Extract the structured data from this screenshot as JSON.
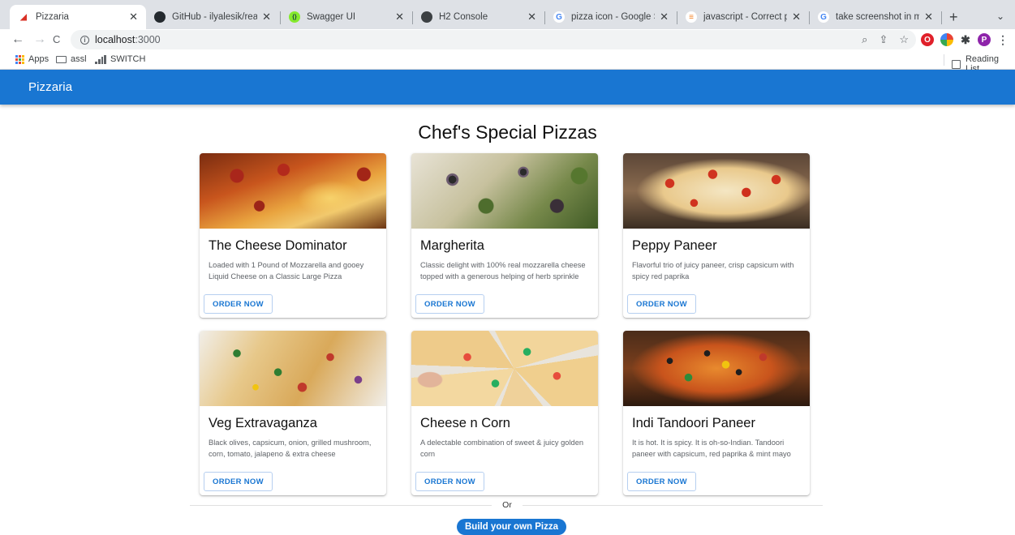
{
  "browser": {
    "tabs": [
      {
        "label": "Pizzaria",
        "close": "✕",
        "color": "#d93025",
        "glyph": "◢"
      },
      {
        "label": "GitHub - ilyalesik/react-fetc",
        "close": "✕",
        "color": "#24292e",
        "glyph": "●"
      },
      {
        "label": "Swagger UI",
        "close": "✕",
        "color": "#85ea2d",
        "glyph": "{}"
      },
      {
        "label": "H2 Console",
        "close": "✕",
        "color": "#3c4043",
        "glyph": "◉"
      },
      {
        "label": "pizza icon - Google Search",
        "close": "✕",
        "color": "#4285f4",
        "glyph": "G"
      },
      {
        "label": "javascript - Correct path for",
        "close": "✕",
        "color": "#f48024",
        "glyph": "≡"
      },
      {
        "label": "take screenshot in mac - Go",
        "close": "✕",
        "color": "#4285f4",
        "glyph": "G"
      }
    ],
    "new_tab": "+",
    "tab_menu": "⌄",
    "nav": {
      "back": "←",
      "forward": "→",
      "reload": "C"
    },
    "url": {
      "info": "i",
      "host": "localhost",
      "port": ":3000"
    },
    "omni_icons": {
      "zoom": "⌕",
      "share": "⇪",
      "star": "☆"
    },
    "extensions": {
      "opera": "O",
      "profile": "P"
    },
    "bookmarks": [
      {
        "label": "Apps"
      },
      {
        "label": "assl"
      },
      {
        "label": "SWITCH"
      }
    ],
    "reading_list": "Reading List"
  },
  "app": {
    "brand": "Pizzaria",
    "primary_color": "#1976d2",
    "heading": "Chef's Special Pizzas",
    "pizzas": [
      {
        "name": "The Cheese Dominator",
        "description": "Loaded with 1 Pound of Mozzarella and gooey Liquid Cheese on a Classic Large Pizza",
        "button": "ORDER NOW"
      },
      {
        "name": "Margherita",
        "description": "Classic delight with 100% real mozzarella cheese topped with a generous helping of herb sprinkle",
        "button": "ORDER NOW"
      },
      {
        "name": "Peppy Paneer",
        "description": "Flavorful trio of juicy paneer, crisp capsicum with spicy red paprika",
        "button": "ORDER NOW"
      },
      {
        "name": "Veg Extravaganza",
        "description": "Black olives, capsicum, onion, grilled mushroom, corn, tomato, jalapeno & extra cheese",
        "button": "ORDER NOW"
      },
      {
        "name": "Cheese n Corn",
        "description": "A delectable combination of sweet & juicy golden corn",
        "button": "ORDER NOW"
      },
      {
        "name": "Indi Tandoori Paneer",
        "description": "It is hot. It is spicy. It is oh-so-Indian. Tandoori paneer with capsicum, red paprika & mint mayo",
        "button": "ORDER NOW"
      }
    ],
    "or_label": "Or",
    "build_button": "Build your own Pizza"
  }
}
